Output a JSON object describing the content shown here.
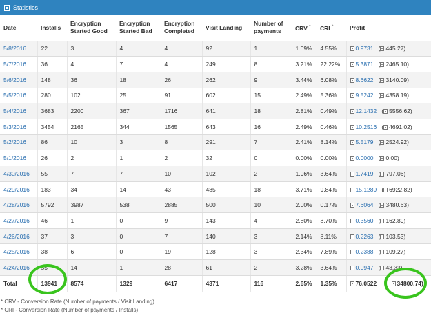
{
  "panel": {
    "title": "Statistics"
  },
  "table": {
    "headers": [
      "Date",
      "Installs",
      "Encryption Started Good",
      "Encryption Started Bad",
      "Encryption Completed",
      "Visit Landing",
      "Number of payments",
      "CRV",
      "CRI",
      "Profit"
    ],
    "header_markers": {
      "crv": "*",
      "cri": "*"
    },
    "rows": [
      [
        "5/8/2016",
        "22",
        "3",
        "4",
        "4",
        "92",
        "1",
        "1.09%",
        "4.55%",
        "0.9731",
        "(",
        "445.27)"
      ],
      [
        "5/7/2016",
        "36",
        "4",
        "7",
        "4",
        "249",
        "8",
        "3.21%",
        "22.22%",
        "5.3871",
        "(",
        "2465.10)"
      ],
      [
        "5/6/2016",
        "148",
        "36",
        "18",
        "26",
        "262",
        "9",
        "3.44%",
        "6.08%",
        "8.6622",
        "(",
        "3140.09)"
      ],
      [
        "5/5/2016",
        "280",
        "102",
        "25",
        "91",
        "602",
        "15",
        "2.49%",
        "5.36%",
        "9.5242",
        "(",
        "4358.19)"
      ],
      [
        "5/4/2016",
        "3683",
        "2200",
        "367",
        "1716",
        "641",
        "18",
        "2.81%",
        "0.49%",
        "12.1432",
        "(",
        "5556.62)"
      ],
      [
        "5/3/2016",
        "3454",
        "2165",
        "344",
        "1565",
        "643",
        "16",
        "2.49%",
        "0.46%",
        "10.2516",
        "(",
        "4691.02)"
      ],
      [
        "5/2/2016",
        "86",
        "10",
        "3",
        "8",
        "291",
        "7",
        "2.41%",
        "8.14%",
        "5.5179",
        "(",
        "2524.92)"
      ],
      [
        "5/1/2016",
        "26",
        "2",
        "1",
        "2",
        "32",
        "0",
        "0.00%",
        "0.00%",
        "0.0000",
        "(",
        "0.00)"
      ],
      [
        "4/30/2016",
        "55",
        "7",
        "7",
        "10",
        "102",
        "2",
        "1.96%",
        "3.64%",
        "1.7419",
        "(",
        "797.06)"
      ],
      [
        "4/29/2016",
        "183",
        "34",
        "14",
        "43",
        "485",
        "18",
        "3.71%",
        "9.84%",
        "15.1289",
        "(",
        "6922.82)"
      ],
      [
        "4/28/2016",
        "5792",
        "3987",
        "538",
        "2885",
        "500",
        "10",
        "2.00%",
        "0.17%",
        "7.6064",
        "(",
        "3480.63)"
      ],
      [
        "4/27/2016",
        "46",
        "1",
        "0",
        "9",
        "143",
        "4",
        "2.80%",
        "8.70%",
        "0.3560",
        "(",
        "162.89)"
      ],
      [
        "4/26/2016",
        "37",
        "3",
        "0",
        "7",
        "140",
        "3",
        "2.14%",
        "8.11%",
        "0.2263",
        "(",
        "103.53)"
      ],
      [
        "4/25/2016",
        "38",
        "6",
        "0",
        "19",
        "128",
        "3",
        "2.34%",
        "7.89%",
        "0.2388",
        "(",
        "109.27)"
      ],
      [
        "4/24/2016",
        "55",
        "14",
        "1",
        "28",
        "61",
        "2",
        "3.28%",
        "3.64%",
        "0.0947",
        "(",
        "43.33)"
      ]
    ],
    "total": [
      "Total",
      "13941",
      "8574",
      "1329",
      "6417",
      "4371",
      "116",
      "2.65%",
      "1.35%",
      "76.0522",
      "",
      "34800.74)"
    ]
  },
  "notes": [
    "* CRV - Conversion Rate (Number of payments / Visit Landing)",
    "* CRI - Conversion Rate (Number of payments / Installs)"
  ],
  "highlight_color": "#39c41d",
  "icons": {
    "header": "document-icon",
    "profit": "currency-icon"
  }
}
